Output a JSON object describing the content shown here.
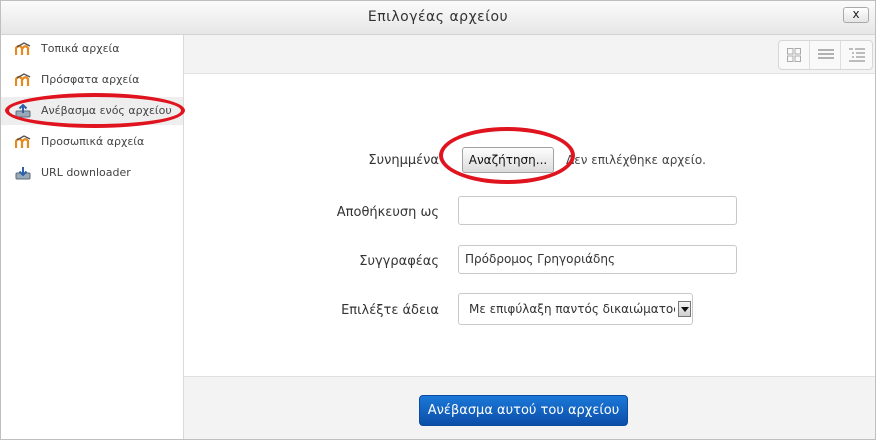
{
  "window": {
    "title": "Επιλογέας αρχείου",
    "close_label": "x"
  },
  "sidebar": {
    "items": [
      {
        "label": "Τοπικά αρχεία",
        "icon": "moodle-icon"
      },
      {
        "label": "Πρόσφατα αρχεία",
        "icon": "moodle-icon"
      },
      {
        "label": "Ανέβασμα ενός αρχείου",
        "icon": "upload-icon",
        "selected": true
      },
      {
        "label": "Προσωπικά αρχεία",
        "icon": "moodle-icon"
      },
      {
        "label": "URL downloader",
        "icon": "url-downloader-icon"
      }
    ]
  },
  "toolbar": {
    "views": [
      "icons-view-icon",
      "list-view-icon",
      "tree-view-icon"
    ]
  },
  "form": {
    "attachment_label": "Συνημμένα",
    "browse_label": "Αναζήτηση...",
    "no_file_text": "Δεν επιλέχθηκε αρχείο.",
    "save_as_label": "Αποθήκευση ως",
    "save_as_value": "",
    "author_label": "Συγγραφέας",
    "author_value": "Πρόδρομος Γρηγοριάδης",
    "license_label": "Επιλέξτε άδεια",
    "license_value": "Με επιφύλαξη παντός δικαιώματος"
  },
  "footer": {
    "upload_label": "Ανέβασμα αυτού του αρχείου"
  },
  "colors": {
    "primary_button": "#0c4ea8",
    "annotation": "#e0141f"
  }
}
